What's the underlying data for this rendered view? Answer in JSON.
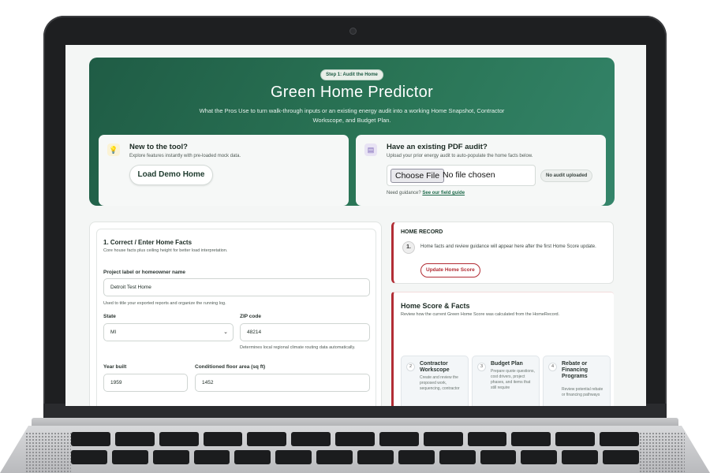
{
  "hero": {
    "step_badge": "Step 1: Audit the Home",
    "title": "Green Home Predictor",
    "subtitle": "What the Pros Use to turn walk-through inputs or an existing energy audit into a working Home Snapshot, Contractor Workscope, and Budget Plan."
  },
  "new_card": {
    "icon": "lightbulb-icon",
    "title": "New to the tool?",
    "text": "Explore features instantly with pre-loaded mock data.",
    "button": "Load Demo Home"
  },
  "pdf_card": {
    "icon": "pdf-document-icon",
    "title": "Have an existing PDF audit?",
    "text": "Upload your prior energy audit to auto-populate the home facts below.",
    "choose_file": "Choose File",
    "file_status": "No file chosen",
    "badge": "No audit uploaded",
    "guidance_prefix": "Need guidance?",
    "guidance_link": "See our field guide"
  },
  "form": {
    "title": "1. Correct / Enter Home Facts",
    "subtitle": "Core house facts plus ceiling height for better load interpretation.",
    "project_label": "Project label or homeowner name",
    "project_value": "Detroit Test Home",
    "project_help": "Used to title your exported reports and organize the running log.",
    "state_label": "State",
    "state_value": "MI",
    "zip_label": "ZIP code",
    "zip_value": "48214",
    "zip_help": "Determines local regional climate routing data automatically.",
    "year_label": "Year built",
    "year_value": "1959",
    "area_label": "Conditioned floor area (sq ft)",
    "area_value": "1452"
  },
  "home_record": {
    "title": "HOME RECORD",
    "step": "1.",
    "text": "Home facts and review guidance will appear here after the first Home Score update.",
    "button": "Update Home Score"
  },
  "score": {
    "title": "Home Score & Facts",
    "subtitle": "Review how the current Green Home Score was calculated from the HomeRecord.",
    "cards": [
      {
        "num": "2",
        "title": "Contractor Workscope",
        "text": "Create and review the proposed work, sequencing, contractor"
      },
      {
        "num": "3",
        "title": "Budget Plan",
        "text": "Prepare quote questions, cost drivers, project phases, and items that still require"
      },
      {
        "num": "4",
        "title": "Rebate or Financing Programs",
        "text": "Review potential rebate or financing pathways"
      }
    ]
  },
  "colors": {
    "hero_green": "#2a7556",
    "accent_red": "#b22d35"
  }
}
